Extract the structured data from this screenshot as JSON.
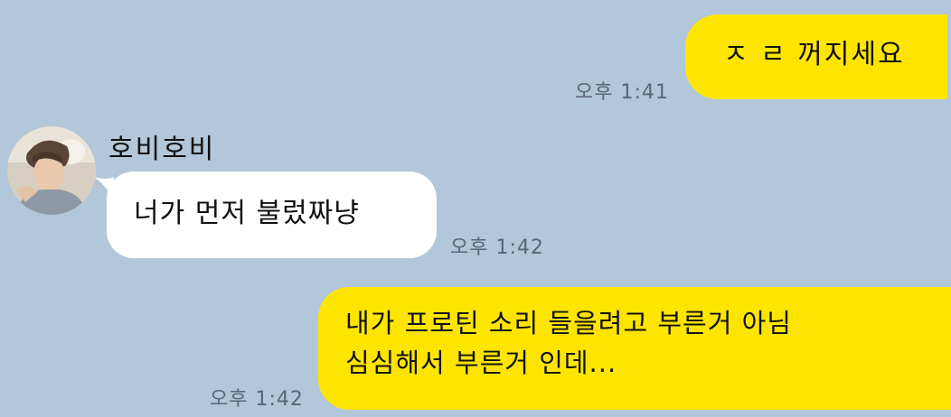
{
  "colors": {
    "background": "#b2c7da",
    "outgoing_bubble": "#fee500",
    "incoming_bubble": "#ffffff",
    "timestamp": "#5a6673"
  },
  "messages": [
    {
      "direction": "outgoing",
      "lines": [
        "ㅈ ㄹ 꺼지세요"
      ],
      "time": "오후 1:41"
    },
    {
      "direction": "incoming",
      "sender": "호비호비",
      "lines": [
        "너가 먼저 불렀짜냥"
      ],
      "time": "오후 1:42"
    },
    {
      "direction": "outgoing",
      "lines": [
        "내가 프로틴 소리 들을려고 부른거 아님",
        "심심해서 부른거 인데..."
      ],
      "time": "오후 1:42"
    }
  ],
  "icons": {
    "avatar": "profile-photo-avatar"
  }
}
